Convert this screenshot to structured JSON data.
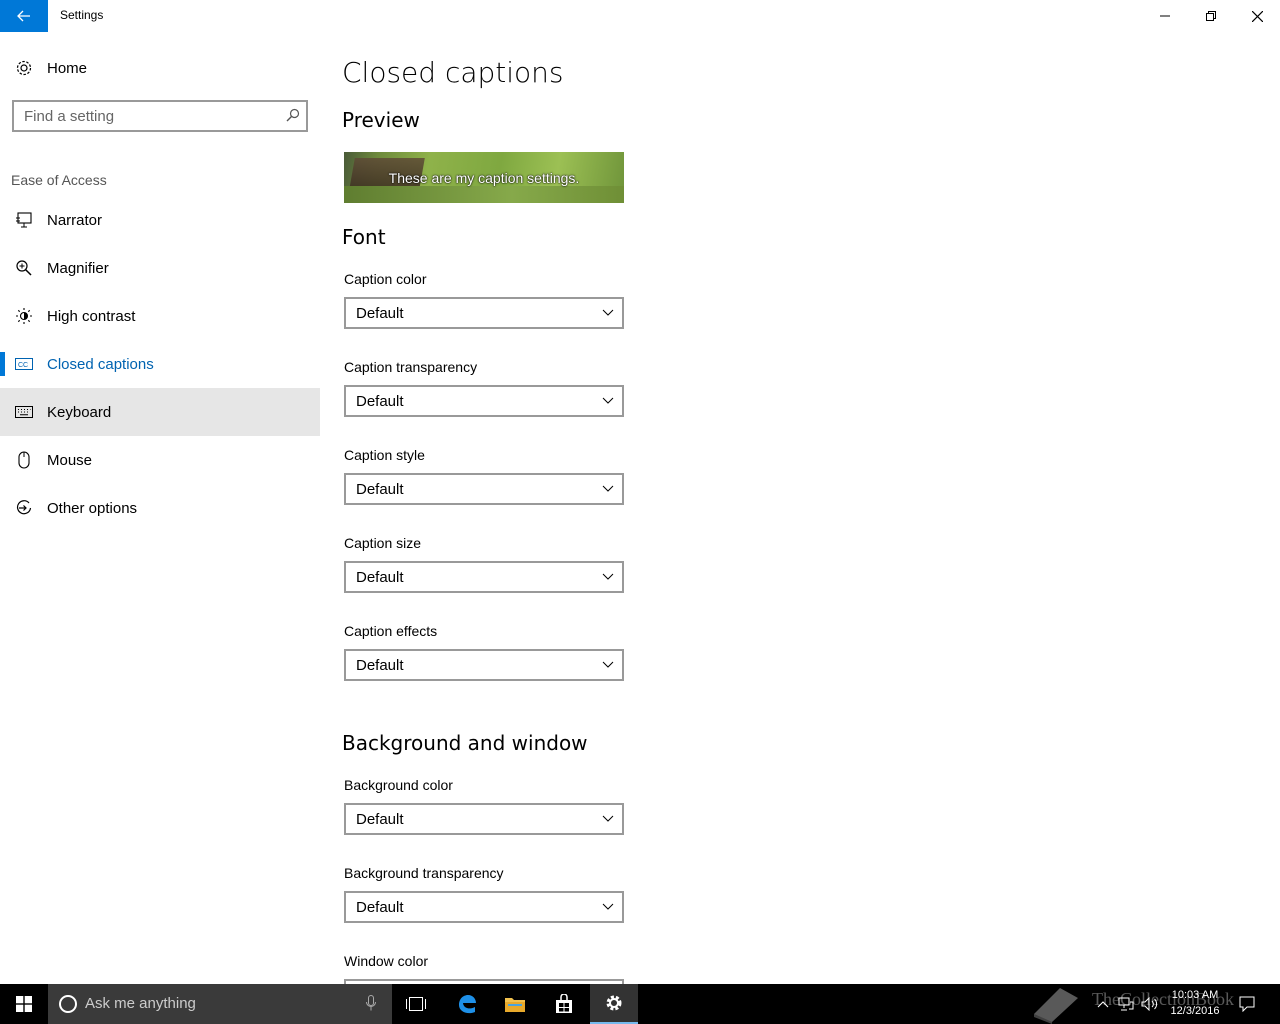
{
  "window": {
    "title": "Settings",
    "back_icon": "back-arrow-icon"
  },
  "sidebar": {
    "home_label": "Home",
    "search_placeholder": "Find a setting",
    "section_label": "Ease of Access",
    "items": [
      {
        "label": "Narrator",
        "icon": "narrator-icon"
      },
      {
        "label": "Magnifier",
        "icon": "magnifier-icon"
      },
      {
        "label": "High contrast",
        "icon": "high-contrast-icon"
      },
      {
        "label": "Closed captions",
        "icon": "closed-captions-icon",
        "active": true
      },
      {
        "label": "Keyboard",
        "icon": "keyboard-icon",
        "hover": true
      },
      {
        "label": "Mouse",
        "icon": "mouse-icon"
      },
      {
        "label": "Other options",
        "icon": "other-options-icon"
      }
    ]
  },
  "main": {
    "title": "Closed captions",
    "preview_heading": "Preview",
    "preview_text": "These are my caption settings.",
    "font_heading": "Font",
    "font_fields": [
      {
        "label": "Caption color",
        "value": "Default"
      },
      {
        "label": "Caption transparency",
        "value": "Default"
      },
      {
        "label": "Caption style",
        "value": "Default"
      },
      {
        "label": "Caption size",
        "value": "Default"
      },
      {
        "label": "Caption effects",
        "value": "Default"
      }
    ],
    "background_heading": "Background and window",
    "background_fields": [
      {
        "label": "Background color",
        "value": "Default"
      },
      {
        "label": "Background transparency",
        "value": "Default"
      },
      {
        "label": "Window color",
        "value": ""
      }
    ]
  },
  "taskbar": {
    "search_text": "Ask me anything",
    "time": "10:03 AM",
    "date": "12/3/2016",
    "watermark": "TheCollectionBook"
  },
  "colors": {
    "accent": "#0078d7",
    "active_text": "#0063b1",
    "hover_bg": "#e6e6e6",
    "taskbar_bg": "#000000"
  }
}
